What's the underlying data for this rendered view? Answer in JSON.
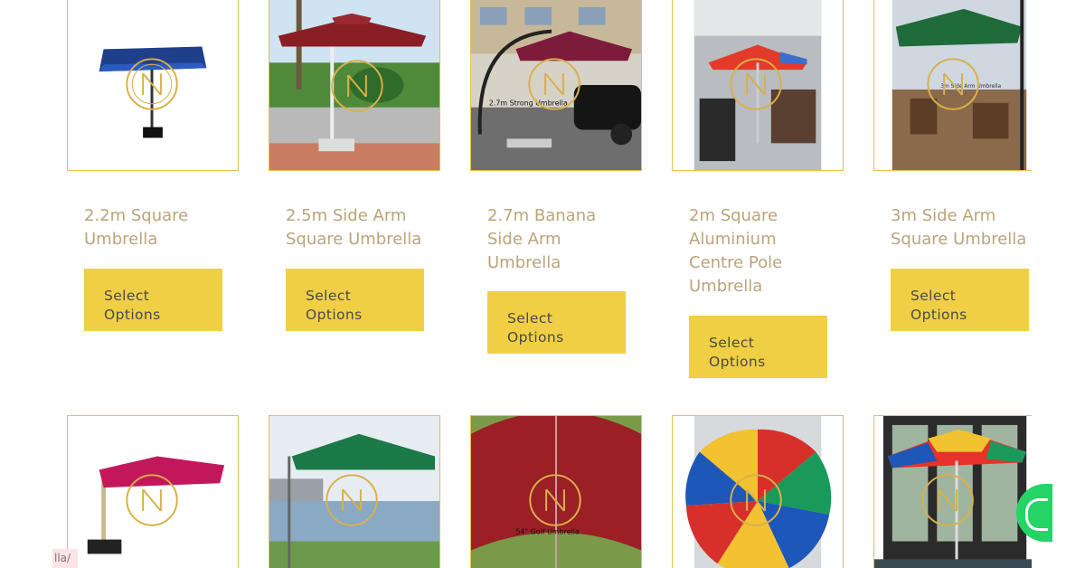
{
  "products_row1": [
    {
      "title": "2.2m Square Umbrella",
      "button": [
        "Select",
        "Options"
      ]
    },
    {
      "title": "2.5m Side Arm Square Umbrella",
      "button": [
        "Select",
        "Options"
      ]
    },
    {
      "title": "2.7m Banana Side Arm Umbrella",
      "button": [
        "Select",
        "Options"
      ]
    },
    {
      "title": "2m Square Aluminium Centre Pole Umbrella",
      "button": [
        "Select",
        "Options"
      ]
    },
    {
      "title": "3m Side Arm Square Umbrella",
      "button": [
        "Select",
        "Options"
      ]
    }
  ],
  "image_captions": {
    "banana": "2.7m Strong Umbrella",
    "side_arm_3m": "3m Side Arm Umbrella",
    "golf": "54\" Golf Umbrella"
  },
  "watermark_icon": "gold-circle-logo-icon",
  "url_hint": "lla/",
  "colors": {
    "accent_button": "#f0cf45",
    "title_text": "#b9a57a",
    "image_border": "#e2c24a",
    "whatsapp": "#25d366"
  }
}
